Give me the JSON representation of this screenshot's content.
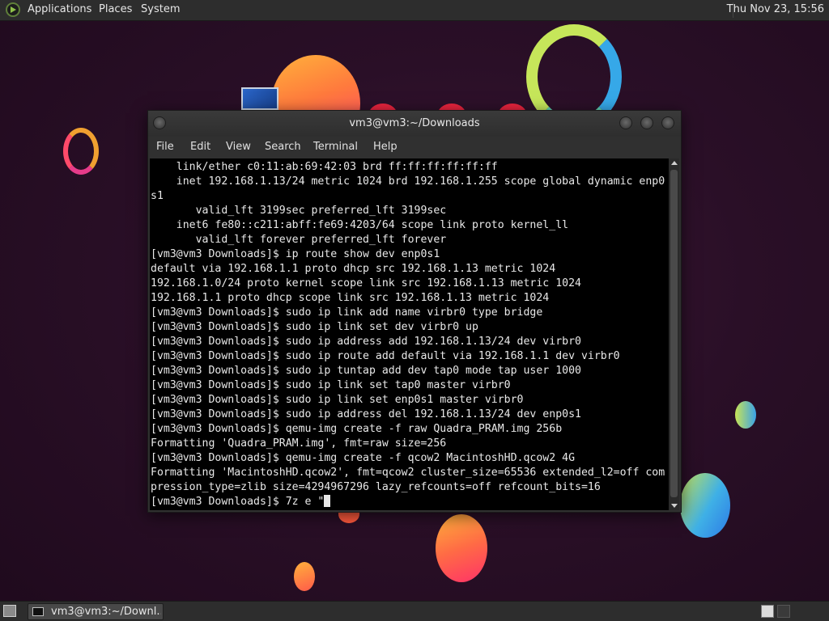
{
  "top_panel": {
    "menus": [
      "Applications",
      "Places",
      "System"
    ],
    "clock": "Thu Nov 23, 15:56"
  },
  "terminal": {
    "title": "vm3@vm3:~/Downloads",
    "menu": [
      "File",
      "Edit",
      "View",
      "Search",
      "Terminal",
      "Help"
    ],
    "lines": [
      "    link/ether c0:11:ab:69:42:03 brd ff:ff:ff:ff:ff:ff",
      "    inet 192.168.1.13/24 metric 1024 brd 192.168.1.255 scope global dynamic enp0",
      "s1",
      "       valid_lft 3199sec preferred_lft 3199sec",
      "    inet6 fe80::c211:abff:fe69:4203/64 scope link proto kernel_ll",
      "       valid_lft forever preferred_lft forever",
      "[vm3@vm3 Downloads]$ ip route show dev enp0s1",
      "default via 192.168.1.1 proto dhcp src 192.168.1.13 metric 1024",
      "192.168.1.0/24 proto kernel scope link src 192.168.1.13 metric 1024",
      "192.168.1.1 proto dhcp scope link src 192.168.1.13 metric 1024",
      "[vm3@vm3 Downloads]$ sudo ip link add name virbr0 type bridge",
      "[vm3@vm3 Downloads]$ sudo ip link set dev virbr0 up",
      "[vm3@vm3 Downloads]$ sudo ip address add 192.168.1.13/24 dev virbr0",
      "[vm3@vm3 Downloads]$ sudo ip route add default via 192.168.1.1 dev virbr0",
      "[vm3@vm3 Downloads]$ sudo ip tuntap add dev tap0 mode tap user 1000",
      "[vm3@vm3 Downloads]$ sudo ip link set tap0 master virbr0",
      "[vm3@vm3 Downloads]$ sudo ip link set enp0s1 master virbr0",
      "[vm3@vm3 Downloads]$ sudo ip address del 192.168.1.13/24 dev enp0s1",
      "[vm3@vm3 Downloads]$ qemu-img create -f raw Quadra_PRAM.img 256b",
      "Formatting 'Quadra_PRAM.img', fmt=raw size=256",
      "[vm3@vm3 Downloads]$ qemu-img create -f qcow2 MacintoshHD.qcow2 4G",
      "Formatting 'MacintoshHD.qcow2', fmt=qcow2 cluster_size=65536 extended_l2=off com",
      "pression_type=zlib size=4294967296 lazy_refcounts=off refcount_bits=16",
      "[vm3@vm3 Downloads]$ 7z e \""
    ]
  },
  "bottom_panel": {
    "task_label": "vm3@vm3:~/Downl..."
  }
}
